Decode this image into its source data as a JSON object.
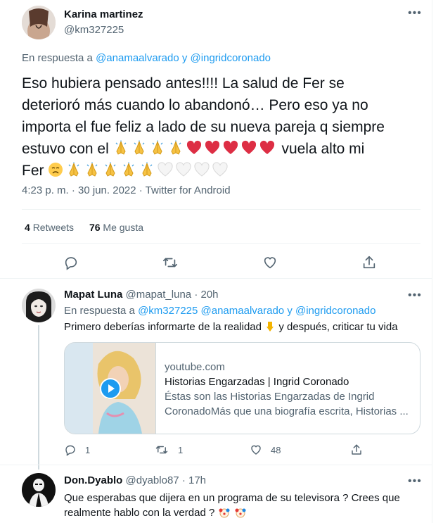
{
  "main_tweet": {
    "author_name": "Karina martinez",
    "author_handle": "@km327225",
    "reply_prefix": "En respuesta a",
    "reply_to": "@anamaalvarado y @ingridcoronado",
    "text_line1": "Eso hubiera pensado antes!!!! La salud de Fer se",
    "text_line2": "deterioró más cuando lo abandonó… Pero eso ya no",
    "text_line3": "importa el fue feliz a lado de su nueva pareja q siempre",
    "text_line4_start": "estuvo con el",
    "text_line4_end": "vuela alto mi",
    "text_line5_start": "Fer",
    "timestamp": "4:23 p. m. · 30 jun. 2022 · Twitter for Android",
    "retweets_count": "4",
    "retweets_label": "Retweets",
    "likes_count": "76",
    "likes_label": "Me gusta",
    "emoji_line4": [
      "folded-hands",
      "folded-hands",
      "folded-hands",
      "folded-hands",
      "red-heart",
      "red-heart",
      "red-heart",
      "red-heart",
      "red-heart"
    ],
    "emoji_line5": [
      "disappointed-face",
      "folded-hands",
      "folded-hands",
      "folded-hands",
      "folded-hands",
      "folded-hands",
      "white-heart",
      "white-heart",
      "white-heart",
      "white-heart"
    ]
  },
  "reply1": {
    "author_name": "Mapat Luna",
    "author_handle": "@mapat_luna",
    "time": "· 20h",
    "reply_prefix": "En respuesta a",
    "reply_to": "@km327225 @anamaalvarado y @ingridcoronado",
    "text_start": "Primero deberías informarte de la realidad",
    "text_end": "y después, criticar tu vida",
    "card": {
      "domain": "youtube.com",
      "title": "Historias Engarzadas | Ingrid Coronado",
      "desc_line1": "Éstas son las Historias Engarzadas de Ingrid",
      "desc_line2": "CoronadoMás que una biografía escrita, Historias ..."
    },
    "reply_count": "1",
    "retweet_count": "1",
    "like_count": "48"
  },
  "reply2": {
    "author_name": "Don.Dyablo",
    "author_handle": "@dyablo87",
    "time": "· 17h",
    "text_line1": "Que esperabas que dijera en un programa de su televisora ? Crees que",
    "text_line2": "realmente hablo con la verdad ?"
  },
  "colors": {
    "link": "#1d9bf0",
    "muted": "#536471",
    "heart": "#f91880"
  }
}
